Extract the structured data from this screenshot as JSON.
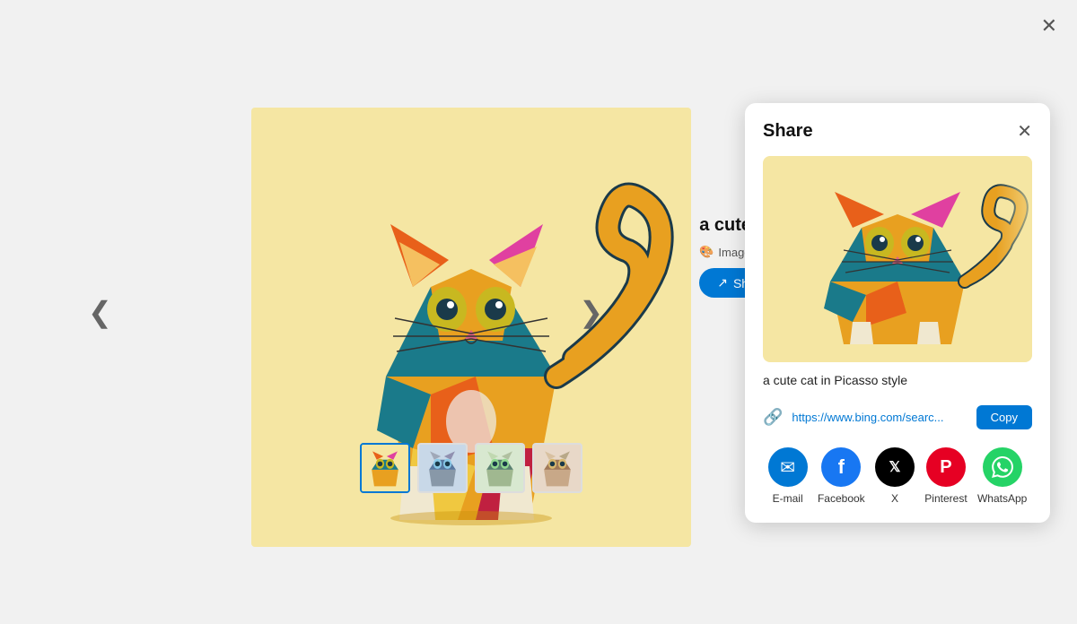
{
  "viewer": {
    "close_label": "✕",
    "nav_left": "❮",
    "nav_right": "❯"
  },
  "info": {
    "title": "a cute cat i",
    "creator": "Image Creator i",
    "share_button": "Share"
  },
  "share_panel": {
    "title": "Share",
    "close_label": "✕",
    "caption": "a cute cat in Picasso style",
    "url": "https://www.bing.com/searc...",
    "copy_label": "Copy",
    "social_items": [
      {
        "name": "email",
        "label": "E-mail",
        "icon": "✉",
        "class": "email"
      },
      {
        "name": "facebook",
        "label": "Facebook",
        "icon": "f",
        "class": "facebook"
      },
      {
        "name": "x",
        "label": "X",
        "icon": "𝕏",
        "class": "x"
      },
      {
        "name": "pinterest",
        "label": "Pinterest",
        "icon": "P",
        "class": "pinterest"
      },
      {
        "name": "whatsapp",
        "label": "WhatsApp",
        "icon": "W",
        "class": "whatsapp"
      }
    ]
  },
  "thumbnails": [
    {
      "id": "thumb1",
      "active": true
    },
    {
      "id": "thumb2",
      "active": false
    },
    {
      "id": "thumb3",
      "active": false
    },
    {
      "id": "thumb4",
      "active": false
    }
  ]
}
